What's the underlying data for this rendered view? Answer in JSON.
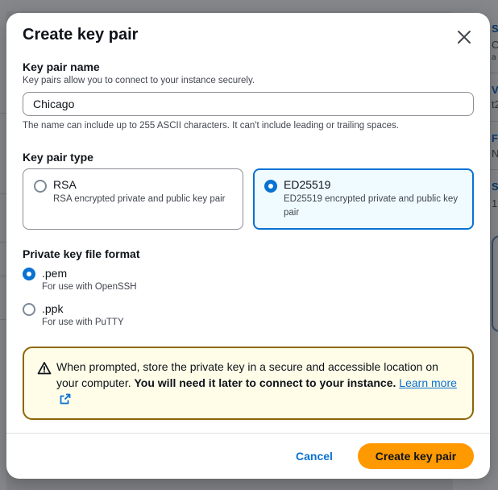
{
  "background": {
    "right_fragments": [
      "S",
      "C",
      "a",
      "V",
      "t2",
      "F",
      "N",
      "S",
      "1"
    ]
  },
  "modal": {
    "title": "Create key pair",
    "close_label": "Close"
  },
  "key_pair_name": {
    "label": "Key pair name",
    "description": "Key pairs allow you to connect to your instance securely.",
    "value": "Chicago",
    "constraint": "The name can include up to 255 ASCII characters. It can't include leading or trailing spaces."
  },
  "key_pair_type": {
    "label": "Key pair type",
    "options": [
      {
        "title": "RSA",
        "description": "RSA encrypted private and public key pair",
        "selected": false
      },
      {
        "title": "ED25519",
        "description": "ED25519 encrypted private and public key pair",
        "selected": true
      }
    ]
  },
  "private_key_format": {
    "label": "Private key file format",
    "options": [
      {
        "title": ".pem",
        "description": "For use with OpenSSH",
        "selected": true
      },
      {
        "title": ".ppk",
        "description": "For use with PuTTY",
        "selected": false
      }
    ]
  },
  "alert": {
    "icon": "warning-icon",
    "text_plain": "When prompted, store the private key in a secure and accessible location on your computer.",
    "text_bold": "You will need it later to connect to your instance.",
    "link_text": "Learn more",
    "link_icon": "external-link-icon"
  },
  "footer": {
    "cancel_label": "Cancel",
    "submit_label": "Create key pair"
  },
  "colors": {
    "accent": "#0972d3",
    "primary_button": "#ff9900",
    "warning_border": "#8d6605",
    "warning_bg": "#fffce8",
    "selected_tile_bg": "#f0fbff"
  }
}
